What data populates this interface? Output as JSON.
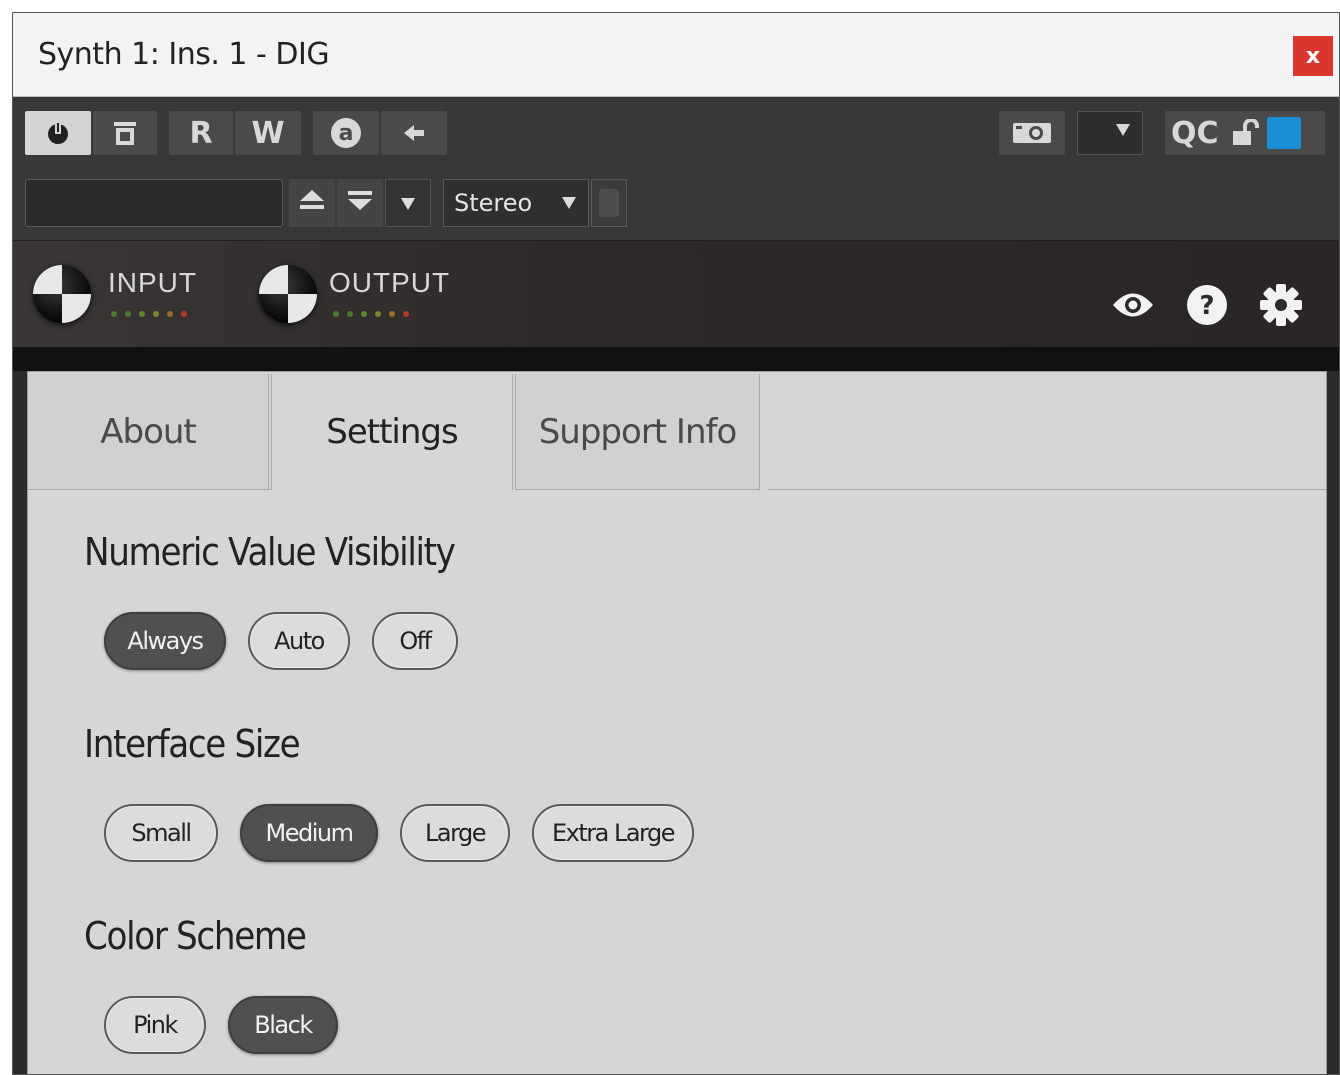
{
  "window": {
    "title": "Synth 1: Ins. 1 - DIG",
    "close_label": "x"
  },
  "toolbar": {
    "buttons": [
      {
        "name": "power",
        "icon": "power-icon",
        "active": true
      },
      {
        "name": "bypass",
        "icon": "bypass-icon",
        "active": false
      },
      {
        "name": "read",
        "label": "R"
      },
      {
        "name": "write",
        "label": "W"
      },
      {
        "name": "automation",
        "icon": "automation-a-icon"
      },
      {
        "name": "back",
        "icon": "arrow-left-icon"
      }
    ],
    "right": {
      "snapshot_icon": "camera-icon",
      "dropdown_icon": "chevron-down-icon",
      "qc_label": "QC",
      "lock_icon": "unlock-icon",
      "color_swatch": "#1a8fd6"
    },
    "preset_name": "",
    "output_mode": "Stereo"
  },
  "plugin_header": {
    "input_label": "INPUT",
    "output_label": "OUTPUT",
    "led_colors": [
      "#4a7a2a",
      "#4a7a2a",
      "#5a8a2a",
      "#7a8a2a",
      "#a06a2a",
      "#b03a2a"
    ],
    "icons": [
      "eye-icon",
      "help-icon",
      "gear-icon"
    ]
  },
  "tabs": [
    {
      "label": "About",
      "active": false
    },
    {
      "label": "Settings",
      "active": true
    },
    {
      "label": "Support Info",
      "active": false
    }
  ],
  "settings": {
    "numeric": {
      "title": "Numeric Value Visibility",
      "options": [
        "Always",
        "Auto",
        "Off"
      ],
      "selected": "Always"
    },
    "size": {
      "title": "Interface Size",
      "options": [
        "Small",
        "Medium",
        "Large",
        "Extra Large"
      ],
      "selected": "Medium"
    },
    "color": {
      "title": "Color Scheme",
      "options": [
        "Pink",
        "Black"
      ],
      "selected": "Black"
    }
  }
}
